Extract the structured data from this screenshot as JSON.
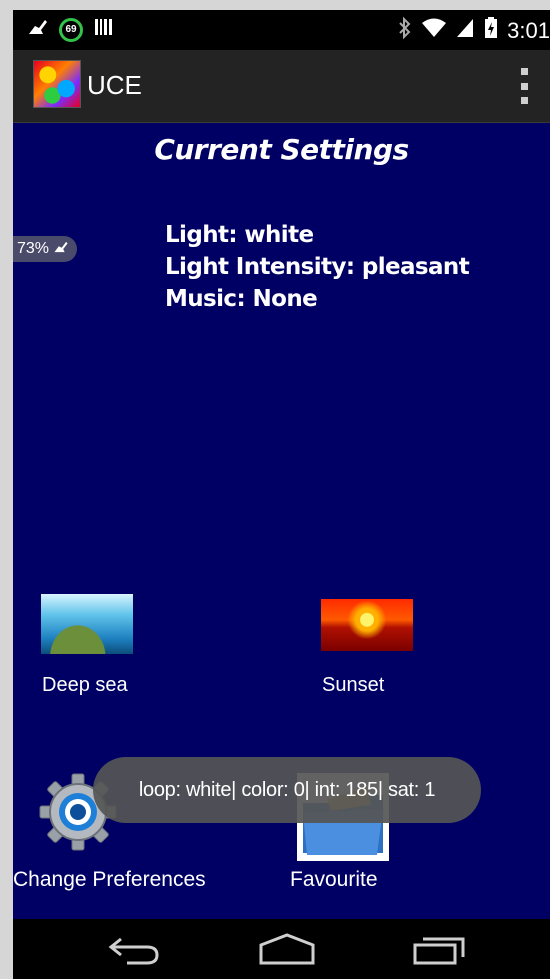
{
  "status_bar": {
    "notification_badge": "69",
    "time": "3:01",
    "icons": [
      "cleaner-icon",
      "counter-circle-icon",
      "barcode-icon",
      "bluetooth-icon",
      "wifi-icon",
      "signal-icon",
      "battery-charging-icon"
    ]
  },
  "action_bar": {
    "title": "UCE",
    "overflow_icon": "overflow-menu-icon"
  },
  "main": {
    "heading": "Current Settings",
    "battery_overlay": "73%",
    "settings": [
      "Light: white",
      "Light Intensity: pleasant",
      "Music: None"
    ],
    "presets": [
      {
        "label": "Deep sea",
        "icon": "deep-sea-thumbnail"
      },
      {
        "label": "Sunset",
        "icon": "sunset-thumbnail"
      }
    ],
    "actions": [
      {
        "label": "Change Preferences",
        "icon": "gear-icon"
      },
      {
        "label": "Favourite",
        "icon": "folder-icon"
      }
    ],
    "toast": "loop: white| color: 0| int: 185| sat: 1"
  },
  "nav_bar": {
    "buttons": [
      "back-icon",
      "home-icon",
      "recent-apps-icon"
    ]
  },
  "colors": {
    "background": "#000064",
    "action_bar": "#232323",
    "toast": "#555555"
  }
}
